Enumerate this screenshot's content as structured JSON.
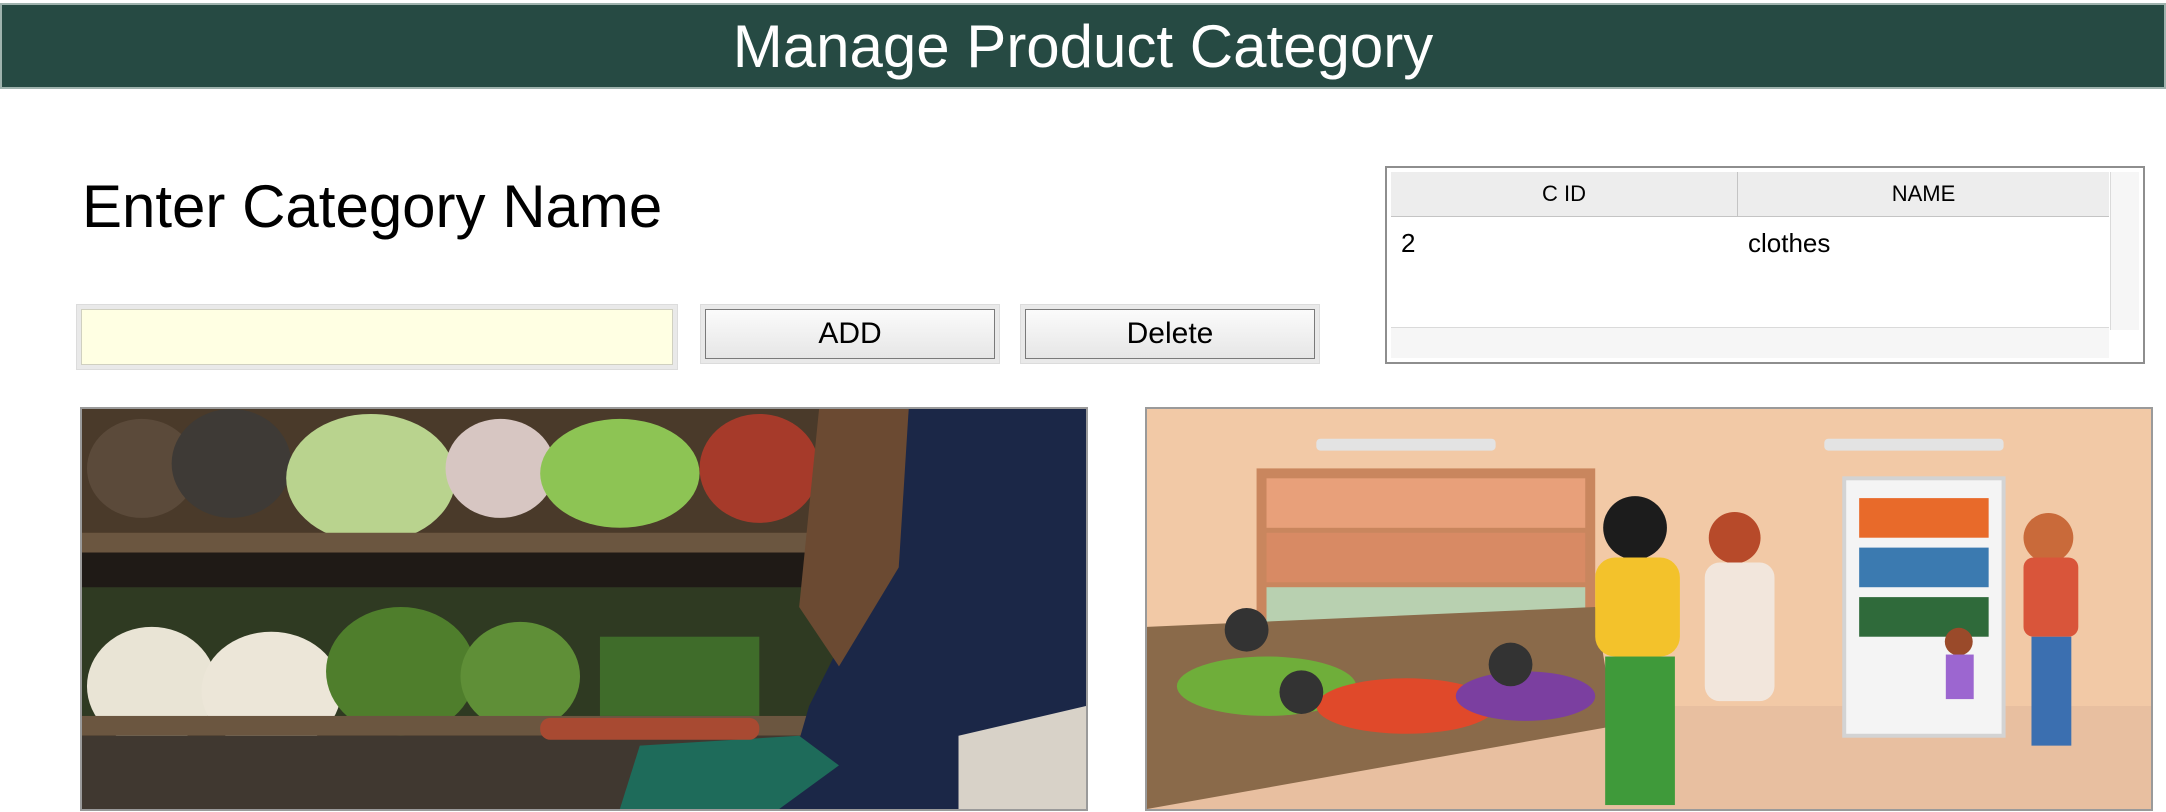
{
  "header": {
    "title": "Manage Product Category"
  },
  "form": {
    "prompt": "Enter Category Name",
    "category_input": {
      "value": "",
      "placeholder": ""
    },
    "add_label": "ADD",
    "delete_label": "Delete"
  },
  "table": {
    "columns": [
      "C ID",
      "NAME"
    ],
    "rows": [
      {
        "id": "2",
        "name": "clothes"
      }
    ]
  },
  "images": {
    "left": "grocery-shopper-photo",
    "right": "supermarket-illustration"
  },
  "colors": {
    "title_bg": "#264a43",
    "input_bg": "#ffffe3"
  }
}
